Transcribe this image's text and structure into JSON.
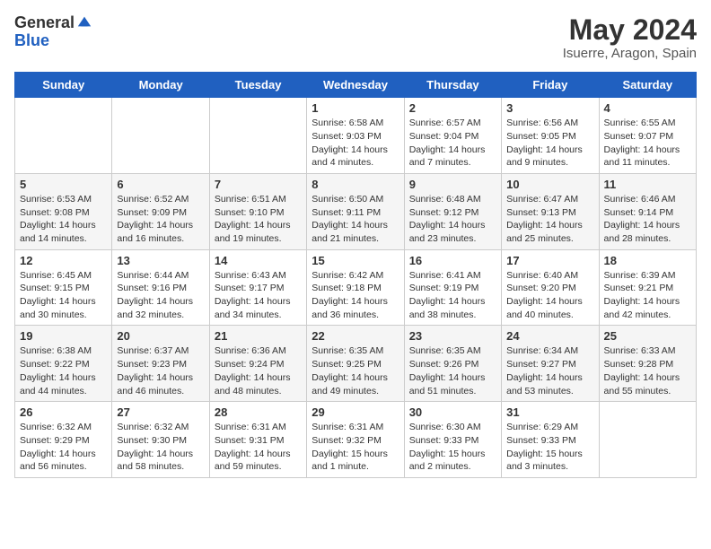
{
  "header": {
    "logo_general": "General",
    "logo_blue": "Blue",
    "title": "May 2024",
    "subtitle": "Isuerre, Aragon, Spain"
  },
  "columns": [
    "Sunday",
    "Monday",
    "Tuesday",
    "Wednesday",
    "Thursday",
    "Friday",
    "Saturday"
  ],
  "weeks": [
    [
      {
        "day": "",
        "info": ""
      },
      {
        "day": "",
        "info": ""
      },
      {
        "day": "",
        "info": ""
      },
      {
        "day": "1",
        "info": "Sunrise: 6:58 AM\nSunset: 9:03 PM\nDaylight: 14 hours\nand 4 minutes."
      },
      {
        "day": "2",
        "info": "Sunrise: 6:57 AM\nSunset: 9:04 PM\nDaylight: 14 hours\nand 7 minutes."
      },
      {
        "day": "3",
        "info": "Sunrise: 6:56 AM\nSunset: 9:05 PM\nDaylight: 14 hours\nand 9 minutes."
      },
      {
        "day": "4",
        "info": "Sunrise: 6:55 AM\nSunset: 9:07 PM\nDaylight: 14 hours\nand 11 minutes."
      }
    ],
    [
      {
        "day": "5",
        "info": "Sunrise: 6:53 AM\nSunset: 9:08 PM\nDaylight: 14 hours\nand 14 minutes."
      },
      {
        "day": "6",
        "info": "Sunrise: 6:52 AM\nSunset: 9:09 PM\nDaylight: 14 hours\nand 16 minutes."
      },
      {
        "day": "7",
        "info": "Sunrise: 6:51 AM\nSunset: 9:10 PM\nDaylight: 14 hours\nand 19 minutes."
      },
      {
        "day": "8",
        "info": "Sunrise: 6:50 AM\nSunset: 9:11 PM\nDaylight: 14 hours\nand 21 minutes."
      },
      {
        "day": "9",
        "info": "Sunrise: 6:48 AM\nSunset: 9:12 PM\nDaylight: 14 hours\nand 23 minutes."
      },
      {
        "day": "10",
        "info": "Sunrise: 6:47 AM\nSunset: 9:13 PM\nDaylight: 14 hours\nand 25 minutes."
      },
      {
        "day": "11",
        "info": "Sunrise: 6:46 AM\nSunset: 9:14 PM\nDaylight: 14 hours\nand 28 minutes."
      }
    ],
    [
      {
        "day": "12",
        "info": "Sunrise: 6:45 AM\nSunset: 9:15 PM\nDaylight: 14 hours\nand 30 minutes."
      },
      {
        "day": "13",
        "info": "Sunrise: 6:44 AM\nSunset: 9:16 PM\nDaylight: 14 hours\nand 32 minutes."
      },
      {
        "day": "14",
        "info": "Sunrise: 6:43 AM\nSunset: 9:17 PM\nDaylight: 14 hours\nand 34 minutes."
      },
      {
        "day": "15",
        "info": "Sunrise: 6:42 AM\nSunset: 9:18 PM\nDaylight: 14 hours\nand 36 minutes."
      },
      {
        "day": "16",
        "info": "Sunrise: 6:41 AM\nSunset: 9:19 PM\nDaylight: 14 hours\nand 38 minutes."
      },
      {
        "day": "17",
        "info": "Sunrise: 6:40 AM\nSunset: 9:20 PM\nDaylight: 14 hours\nand 40 minutes."
      },
      {
        "day": "18",
        "info": "Sunrise: 6:39 AM\nSunset: 9:21 PM\nDaylight: 14 hours\nand 42 minutes."
      }
    ],
    [
      {
        "day": "19",
        "info": "Sunrise: 6:38 AM\nSunset: 9:22 PM\nDaylight: 14 hours\nand 44 minutes."
      },
      {
        "day": "20",
        "info": "Sunrise: 6:37 AM\nSunset: 9:23 PM\nDaylight: 14 hours\nand 46 minutes."
      },
      {
        "day": "21",
        "info": "Sunrise: 6:36 AM\nSunset: 9:24 PM\nDaylight: 14 hours\nand 48 minutes."
      },
      {
        "day": "22",
        "info": "Sunrise: 6:35 AM\nSunset: 9:25 PM\nDaylight: 14 hours\nand 49 minutes."
      },
      {
        "day": "23",
        "info": "Sunrise: 6:35 AM\nSunset: 9:26 PM\nDaylight: 14 hours\nand 51 minutes."
      },
      {
        "day": "24",
        "info": "Sunrise: 6:34 AM\nSunset: 9:27 PM\nDaylight: 14 hours\nand 53 minutes."
      },
      {
        "day": "25",
        "info": "Sunrise: 6:33 AM\nSunset: 9:28 PM\nDaylight: 14 hours\nand 55 minutes."
      }
    ],
    [
      {
        "day": "26",
        "info": "Sunrise: 6:32 AM\nSunset: 9:29 PM\nDaylight: 14 hours\nand 56 minutes."
      },
      {
        "day": "27",
        "info": "Sunrise: 6:32 AM\nSunset: 9:30 PM\nDaylight: 14 hours\nand 58 minutes."
      },
      {
        "day": "28",
        "info": "Sunrise: 6:31 AM\nSunset: 9:31 PM\nDaylight: 14 hours\nand 59 minutes."
      },
      {
        "day": "29",
        "info": "Sunrise: 6:31 AM\nSunset: 9:32 PM\nDaylight: 15 hours\nand 1 minute."
      },
      {
        "day": "30",
        "info": "Sunrise: 6:30 AM\nSunset: 9:33 PM\nDaylight: 15 hours\nand 2 minutes."
      },
      {
        "day": "31",
        "info": "Sunrise: 6:29 AM\nSunset: 9:33 PM\nDaylight: 15 hours\nand 3 minutes."
      },
      {
        "day": "",
        "info": ""
      }
    ]
  ]
}
